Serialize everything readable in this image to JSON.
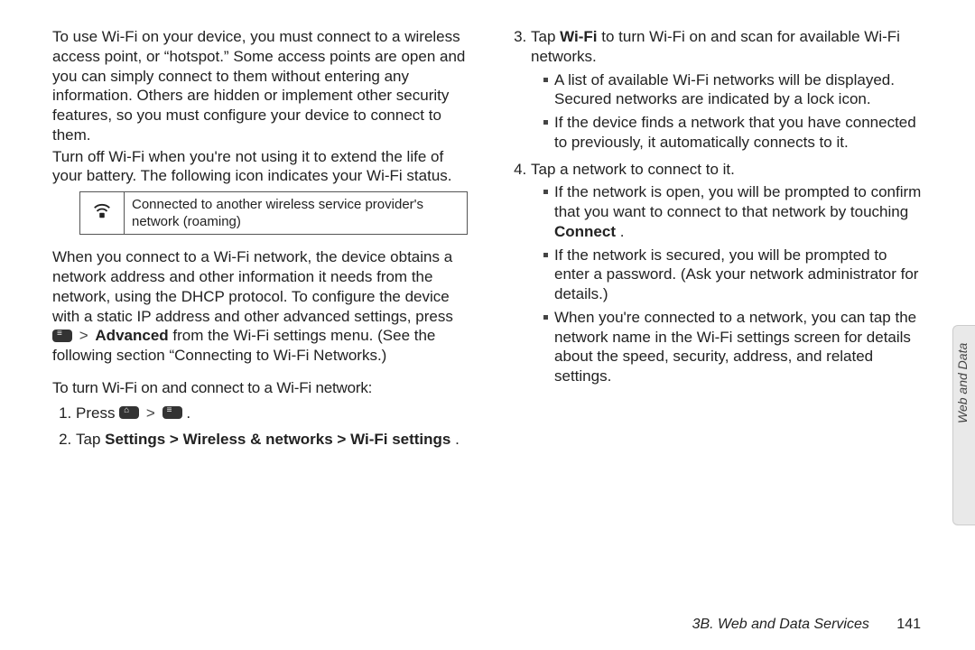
{
  "left": {
    "p1": "To use Wi-Fi on your device, you must connect to a wireless access point, or “hotspot.” Some access points are open and you can simply connect to them without entering any information. Others are hidden or implement other security features, so you must configure your device to connect to them.",
    "p2": "Turn off Wi-Fi when you're not using it to extend the life of your battery. The following icon indicates your Wi-Fi status.",
    "tbl_icon_name": "wifi-roaming-icon",
    "tbl_text": "Connected to another wireless service provider's network (roaming)",
    "p3a": "When you connect to a Wi-Fi network, the device obtains a network address and other information it needs from the network, using the DHCP protocol. To configure the device with a static IP address and other advanced settings, press ",
    "p3_gt": ">",
    "p3_bold": "Advanced",
    "p3b": " from the Wi-Fi settings menu. (See the following section “Connecting to Wi-Fi Networks.)",
    "sub": "To turn Wi-Fi on and connect to a Wi-Fi network:",
    "step1_pre": "Press ",
    "step1_gt": ">",
    "step1_post": ".",
    "step2_pre": "Tap ",
    "step2_bold": "Settings > Wireless & networks > Wi-Fi settings",
    "step2_post": "."
  },
  "right": {
    "step3_pre": "Tap ",
    "step3_bold": "Wi-Fi",
    "step3_post": " to turn Wi-Fi on and scan for available Wi-Fi networks.",
    "s3a": "A list of available Wi-Fi networks will be displayed. Secured networks are indicated by a lock icon.",
    "s3b": "If the device finds a network that you have connected to previously, it automatically connects to it.",
    "step4": "Tap a network to connect to it.",
    "s4a_pre": "If the network is open, you will be prompted to confirm that you want to connect to that network by touching ",
    "s4a_bold": "Connect",
    "s4a_post": ".",
    "s4b": "If the network is secured, you will be prompted to enter a password. (Ask your network administrator for details.)",
    "s4c": "When you're connected to a network, you can tap the network name in the Wi-Fi settings screen for details about the speed, security, address, and related settings."
  },
  "footer": {
    "section": "3B. Web and Data Services",
    "page": "141"
  },
  "sidetab": "Web and Data"
}
